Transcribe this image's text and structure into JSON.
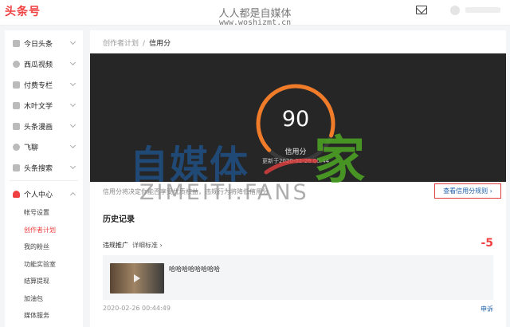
{
  "topbar": {
    "logo": "头条号",
    "watermark_title": "人人都是自媒体",
    "watermark_url": "www.woshizmt.cn"
  },
  "sidebar": {
    "items": [
      {
        "label": "今日头条",
        "icon": "toutiao-icon"
      },
      {
        "label": "西瓜视频",
        "icon": "xigua-video-icon"
      },
      {
        "label": "付费专栏",
        "icon": "paid-column-icon"
      },
      {
        "label": "木叶文学",
        "icon": "literature-icon"
      },
      {
        "label": "头条漫画",
        "icon": "comic-icon"
      },
      {
        "label": "飞聊",
        "icon": "feiliao-icon"
      },
      {
        "label": "头条搜索",
        "icon": "search-icon"
      }
    ],
    "personal": {
      "label": "个人中心",
      "icon": "user-icon",
      "children": [
        "帐号设置",
        "创作者计划",
        "我的粉丝",
        "功能实验室",
        "结算提现",
        "加油包",
        "媒体服务"
      ],
      "active_index": 1
    }
  },
  "main": {
    "breadcrumb": {
      "parent": "创作者计划",
      "separator": "/",
      "current": "信用分"
    },
    "score": {
      "value": "90",
      "label": "信用分",
      "updated": "更新于2020-02-26 00:44",
      "max": 100
    },
    "description": "信用分将决定你能否享受优质权益，违规行为将降低信用分",
    "rules_button": "查看信用分规则 ›",
    "history_title": "历史记录",
    "record": {
      "category": "违规推广",
      "detail_link": "详细标准 ›",
      "penalty": "-5",
      "content_title": "哈哈哈哈哈哈哈哈",
      "date": "2020-02-26 00:44:49",
      "appeal": "申诉"
    }
  },
  "watermark": {
    "cn_main": "自媒体",
    "cn_swoosh": "之",
    "cn_home": "家",
    "en": "ZIMEITI.FANS"
  },
  "colors": {
    "accent": "#f04142",
    "link": "#1f5fa8",
    "ring": "#f07c2a",
    "hero_bg": "#262626"
  }
}
